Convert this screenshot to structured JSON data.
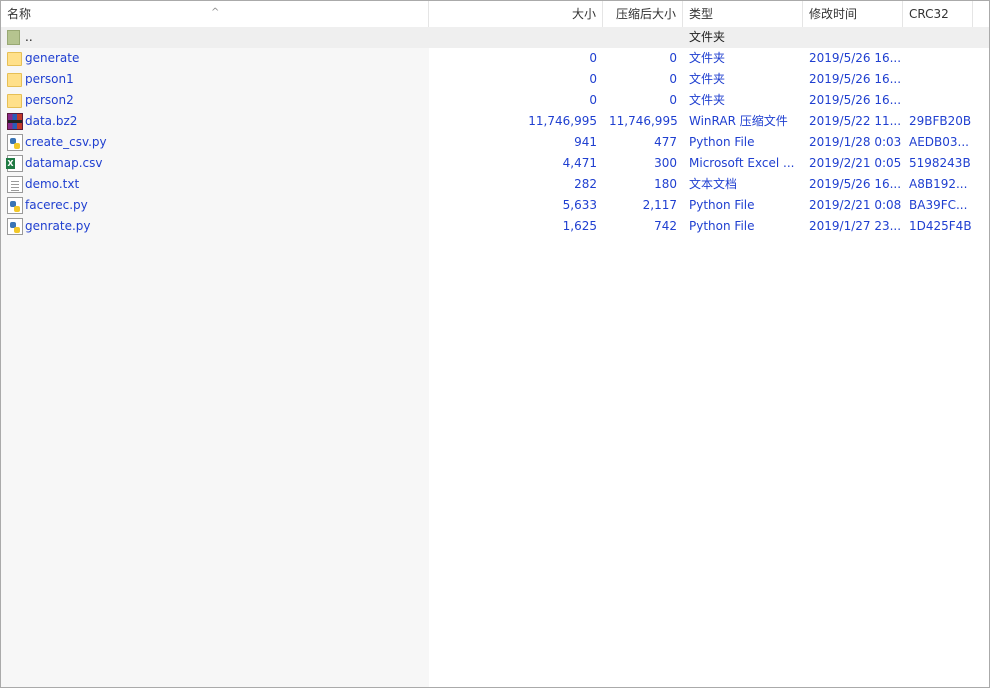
{
  "header": {
    "name": "名称",
    "size": "大小",
    "packed": "压缩后大小",
    "type": "类型",
    "modified": "修改时间",
    "crc": "CRC32",
    "sort_indicator": "^"
  },
  "rows": [
    {
      "name": "..",
      "icon": "parent-folder-icon",
      "size": "",
      "packed": "",
      "type": "文件夹",
      "modified": "",
      "crc": ""
    },
    {
      "name": "generate",
      "icon": "folder-icon",
      "size": "0",
      "packed": "0",
      "type": "文件夹",
      "modified": "2019/5/26 16...",
      "crc": ""
    },
    {
      "name": "person1",
      "icon": "folder-icon",
      "size": "0",
      "packed": "0",
      "type": "文件夹",
      "modified": "2019/5/26 16...",
      "crc": ""
    },
    {
      "name": "person2",
      "icon": "folder-icon",
      "size": "0",
      "packed": "0",
      "type": "文件夹",
      "modified": "2019/5/26 16...",
      "crc": ""
    },
    {
      "name": "data.bz2",
      "icon": "winrar-archive-icon",
      "size": "11,746,995",
      "packed": "11,746,995",
      "type": "WinRAR 压缩文件",
      "modified": "2019/5/22 11...",
      "crc": "29BFB20B"
    },
    {
      "name": "create_csv.py",
      "icon": "python-file-icon",
      "size": "941",
      "packed": "477",
      "type": "Python File",
      "modified": "2019/1/28 0:03",
      "crc": "AEDB03..."
    },
    {
      "name": "datamap.csv",
      "icon": "excel-file-icon",
      "size": "4,471",
      "packed": "300",
      "type": "Microsoft Excel ...",
      "modified": "2019/2/21 0:05",
      "crc": "5198243B"
    },
    {
      "name": "demo.txt",
      "icon": "text-file-icon",
      "size": "282",
      "packed": "180",
      "type": "文本文档",
      "modified": "2019/5/26 16...",
      "crc": "A8B192..."
    },
    {
      "name": "facerec.py",
      "icon": "python-file-icon",
      "size": "5,633",
      "packed": "2,117",
      "type": "Python File",
      "modified": "2019/2/21 0:08",
      "crc": "BA39FC..."
    },
    {
      "name": "genrate.py",
      "icon": "python-file-icon",
      "size": "1,625",
      "packed": "742",
      "type": "Python File",
      "modified": "2019/1/27 23...",
      "crc": "1D425F4B"
    }
  ],
  "colors": {
    "file_text": "#1f3fd0",
    "parent_row_bg": "#efefef",
    "name_column_bg": "#f7f7f7"
  }
}
